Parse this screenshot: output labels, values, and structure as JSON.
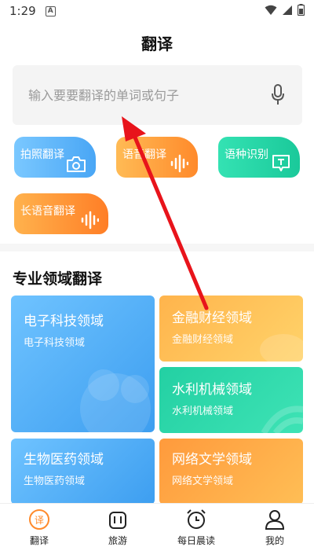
{
  "status": {
    "time": "1:29",
    "badge": "A"
  },
  "header": {
    "title": "翻译"
  },
  "search": {
    "placeholder": "输入要要翻译的单词或句子"
  },
  "features": [
    {
      "label": "拍照翻译",
      "icon": "camera-icon"
    },
    {
      "label": "语音翻译",
      "icon": "voice-wave-icon"
    },
    {
      "label": "语种识别",
      "icon": "text-bubble-icon"
    },
    {
      "label": "长语音翻译",
      "icon": "voice-wave-icon"
    }
  ],
  "section": {
    "title": "专业领域翻译"
  },
  "domains": [
    {
      "title": "电子科技领域",
      "subtitle": "电子科技领域"
    },
    {
      "title": "金融财经领域",
      "subtitle": "金融财经领域"
    },
    {
      "title": "水利机械领域",
      "subtitle": "水利机械领域"
    },
    {
      "title": "生物医药领域",
      "subtitle": "生物医药领域"
    },
    {
      "title": "网络文学领域",
      "subtitle": "网络文学领域"
    }
  ],
  "nav": [
    {
      "label": "翻译",
      "icon": "translate-icon",
      "active": true
    },
    {
      "label": "旅游",
      "icon": "luggage-icon",
      "active": false
    },
    {
      "label": "每日晨读",
      "icon": "alarm-clock-icon",
      "active": false
    },
    {
      "label": "我的",
      "icon": "user-icon",
      "active": false
    }
  ],
  "colors": {
    "accent": "#ff7e26",
    "blue": "#3d9ef0",
    "green": "#1ac99a",
    "arrow": "#e8141b"
  }
}
